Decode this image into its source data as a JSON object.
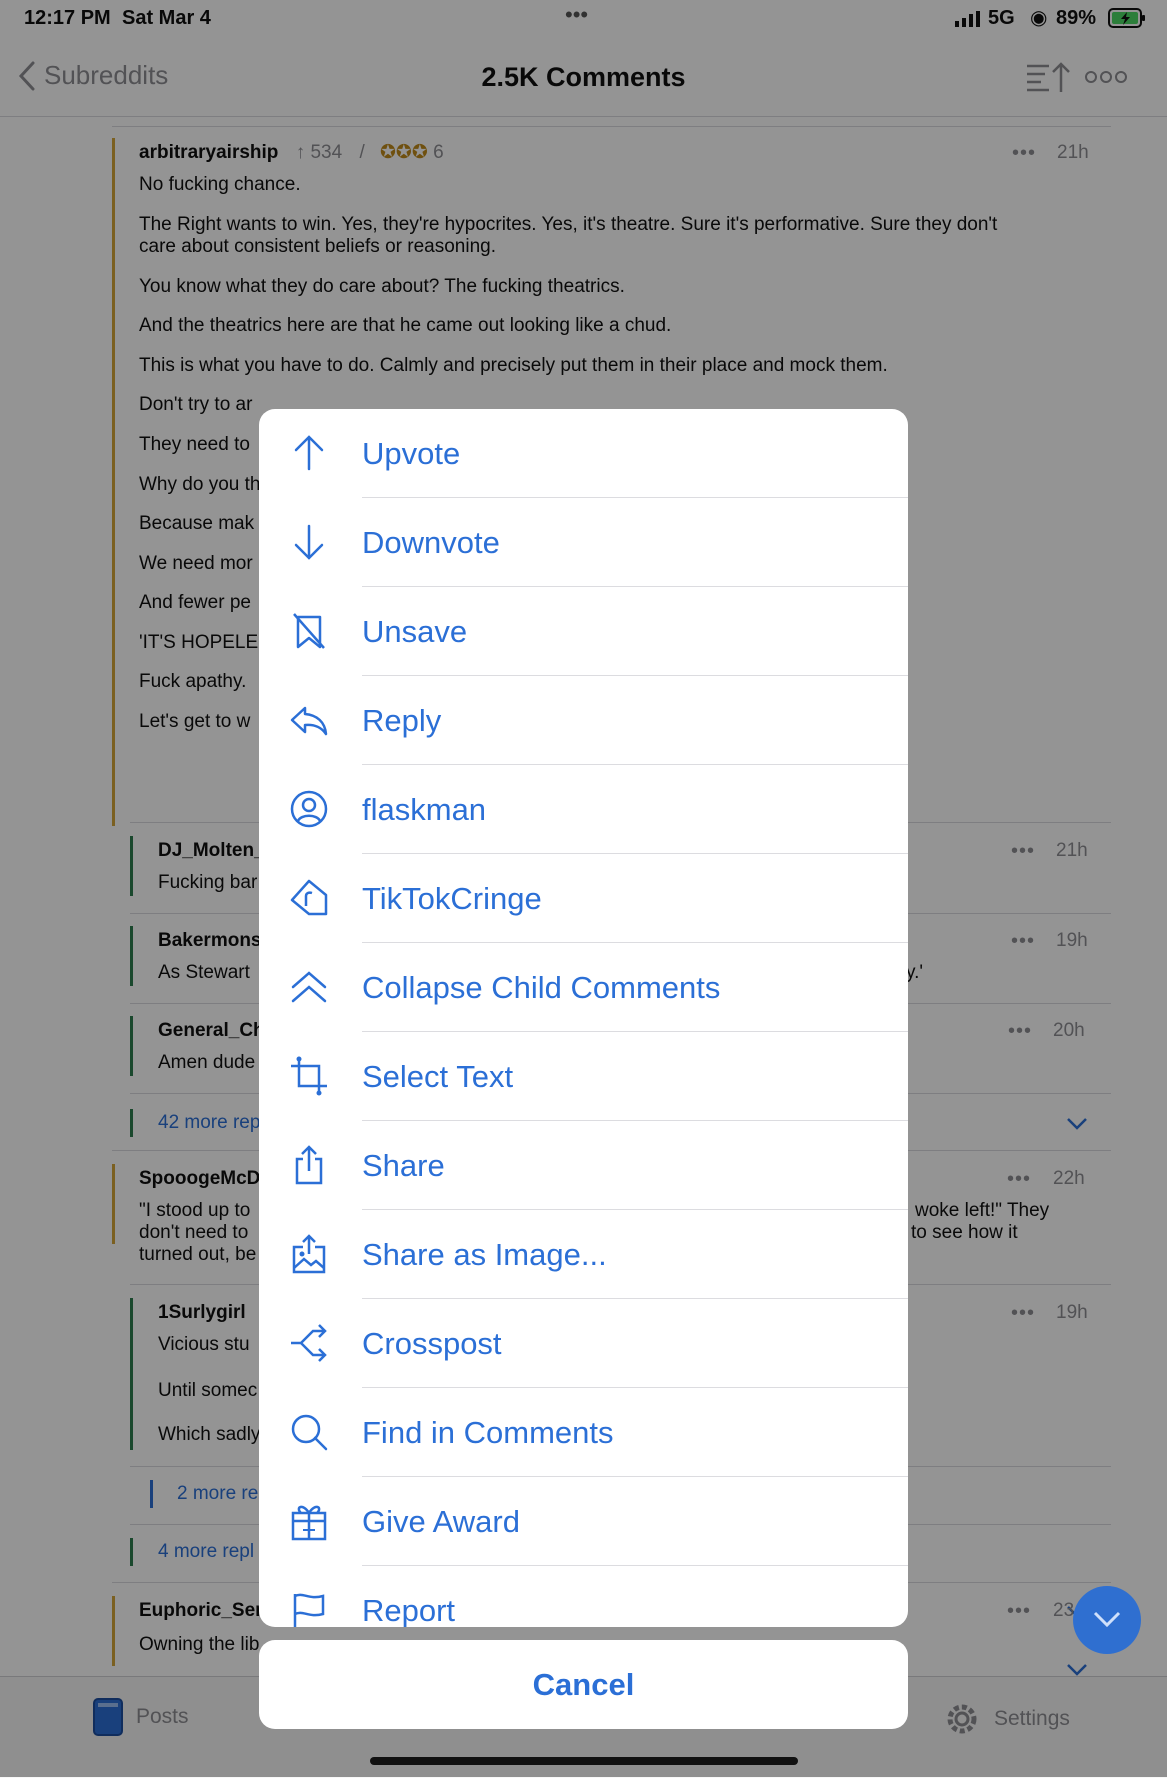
{
  "status": {
    "time": "12:17 PM",
    "date": "Sat Mar 4",
    "network": "5G",
    "battery": "89%"
  },
  "nav": {
    "back_label": "Subreddits",
    "title": "2.5K Comments"
  },
  "comments": [
    {
      "author": "arbitraryairship",
      "score": "534",
      "awards": "6",
      "time": "21h",
      "lines": [
        "No fucking chance.",
        "The Right wants to win. Yes, they're hypocrites. Yes, it's theatre. Sure it's performative. Sure they don't",
        "care about consistent beliefs or reasoning.",
        "You know what they do care about? The fucking theatrics.",
        "And the theatrics here are that he came out looking like a chud.",
        "This is what you have to do. Calmly and precisely put them in their place and mock them.",
        "Don't try to ar",
        "They need to",
        "Why do you th",
        "Because mak",
        "We need mor",
        "And fewer pe",
        "'IT'S HOPELE",
        "Fuck apathy.",
        "Let's get to w"
      ]
    },
    {
      "author": "DJ_Molten_",
      "time": "21h",
      "text": "Fucking bar"
    },
    {
      "author": "Bakermons",
      "time": "19h",
      "text": "As Stewart",
      "tail": "y.'"
    },
    {
      "author": "General_Ch",
      "time": "20h",
      "text": "Amen dude"
    },
    {
      "more": "42 more rep"
    },
    {
      "author": "SpooogeMcD",
      "time": "22h",
      "lines": [
        "\"I stood up to",
        "don't need to",
        "turned out, be"
      ],
      "right_lines": [
        "woke left!\" They",
        "to see how it"
      ]
    },
    {
      "author": "1Surlygirl",
      "time": "19h",
      "lines": [
        "Vicious stu",
        "Until somec",
        "Which sadly"
      ]
    },
    {
      "more2": "2 more re"
    },
    {
      "more3": "4 more repl"
    },
    {
      "author": "Euphoric_Ser",
      "time": "23",
      "text": "Owning the lib"
    }
  ],
  "tabbar": {
    "posts": "Posts",
    "settings": "Settings"
  },
  "action_sheet": {
    "items": [
      {
        "label": "Upvote",
        "icon": "arrow-up-icon"
      },
      {
        "label": "Downvote",
        "icon": "arrow-down-icon"
      },
      {
        "label": "Unsave",
        "icon": "bookmark-slash-icon"
      },
      {
        "label": "Reply",
        "icon": "reply-icon"
      },
      {
        "label": "flaskman",
        "icon": "user-circle-icon"
      },
      {
        "label": "TikTokCringe",
        "icon": "subreddit-tag-icon"
      },
      {
        "label": "Collapse Child Comments",
        "icon": "double-chevron-up-icon"
      },
      {
        "label": "Select Text",
        "icon": "crop-icon"
      },
      {
        "label": "Share",
        "icon": "share-icon"
      },
      {
        "label": "Share as Image...",
        "icon": "share-image-icon"
      },
      {
        "label": "Crosspost",
        "icon": "crosspost-icon"
      },
      {
        "label": "Find in Comments",
        "icon": "search-icon"
      },
      {
        "label": "Give Award",
        "icon": "gift-icon"
      },
      {
        "label": "Report",
        "icon": "flag-icon"
      }
    ],
    "cancel": "Cancel"
  }
}
